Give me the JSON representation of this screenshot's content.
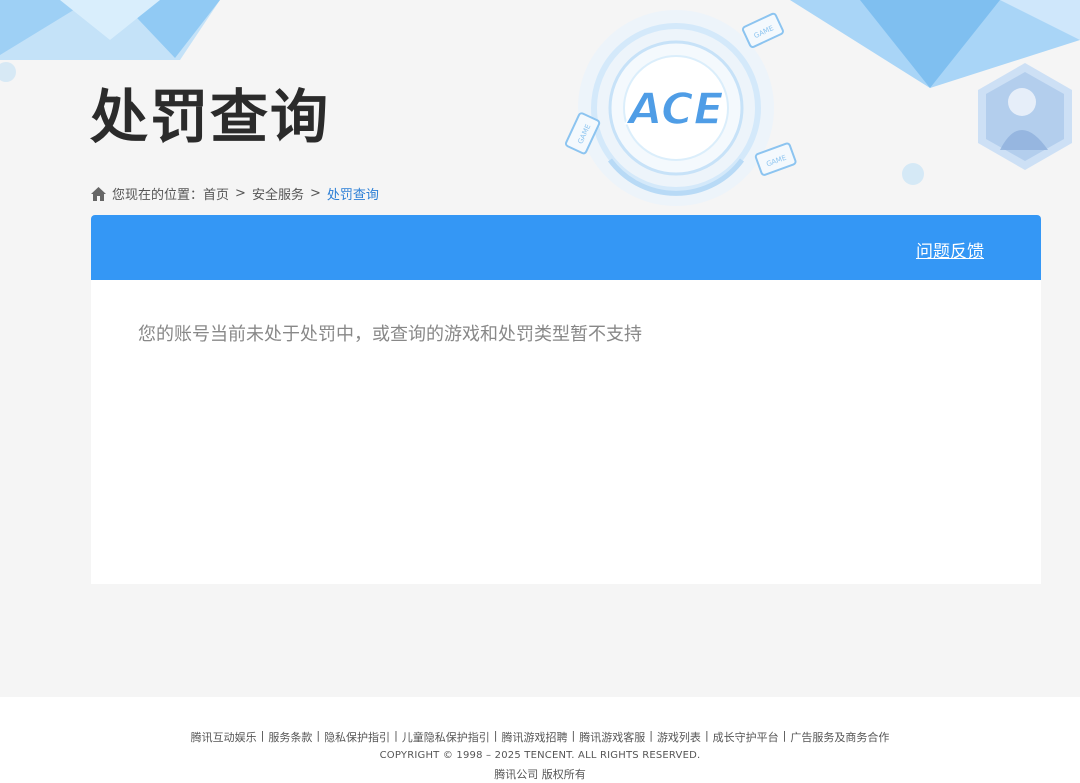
{
  "page": {
    "title": "处罚查询"
  },
  "logo": {
    "text": "ACE",
    "badge_text": "GAME"
  },
  "breadcrumb": {
    "prefix": "您现在的位置：",
    "items": [
      "首页",
      "安全服务",
      "处罚查询"
    ],
    "separator": ">"
  },
  "panel": {
    "feedback_label": "问题反馈",
    "message": "您的账号当前未处于处罚中，或查询的游戏和处罚类型暂不支持"
  },
  "footer": {
    "links": [
      "腾讯互动娱乐",
      "服务条款",
      "隐私保护指引",
      "儿童隐私保护指引",
      "腾讯游戏招聘",
      "腾讯游戏客服",
      "游戏列表",
      "成长守护平台",
      "广告服务及商务合作"
    ],
    "divider": "|",
    "copyright": "COPYRIGHT © 1998 – 2025 TENCENT. ALL RIGHTS RESERVED.",
    "company": "腾讯公司 版权所有"
  },
  "colors": {
    "accent": "#3497f5",
    "title": "#2b2b2b",
    "breadcrumb_current": "#2c7fd6",
    "message": "#888888"
  },
  "icons": {
    "home": "home-icon",
    "logo": "ace-logo-icon",
    "avatar": "character-avatar-icon"
  }
}
